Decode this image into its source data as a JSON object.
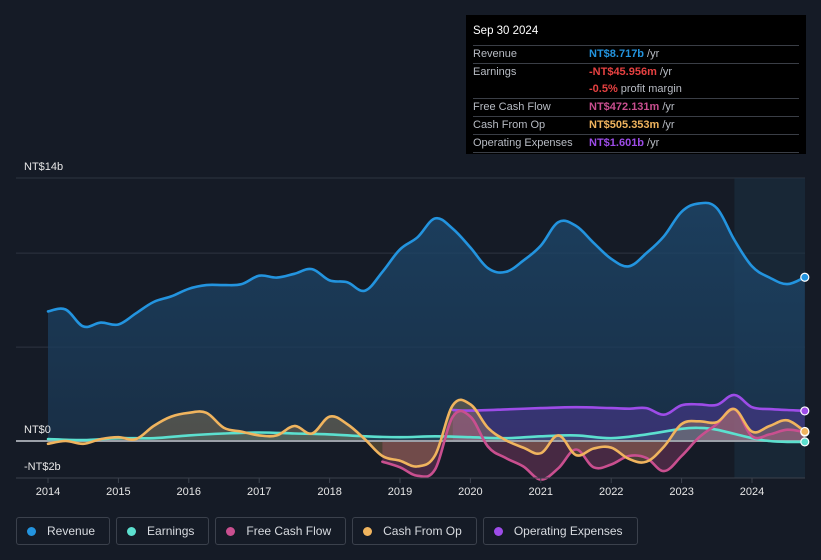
{
  "tooltip": {
    "date": "Sep 30 2024",
    "rows": [
      {
        "label": "Revenue",
        "value": "NT$8.717b",
        "suffix": "/yr",
        "color": "#2394df"
      },
      {
        "label": "Earnings",
        "value": "-NT$45.956m",
        "suffix": "/yr",
        "color": "#e64141"
      },
      {
        "label": "",
        "value": "-0.5%",
        "suffix": "profit margin",
        "color": "#e64141"
      },
      {
        "label": "Free Cash Flow",
        "value": "NT$472.131m",
        "suffix": "/yr",
        "color": "#c94f8f"
      },
      {
        "label": "Cash From Op",
        "value": "NT$505.353m",
        "suffix": "/yr",
        "color": "#f0b45e"
      },
      {
        "label": "Operating Expenses",
        "value": "NT$1.601b",
        "suffix": "/yr",
        "color": "#9d4ce8"
      }
    ]
  },
  "legend": [
    {
      "label": "Revenue",
      "color": "#2394df"
    },
    {
      "label": "Earnings",
      "color": "#5ce0cf"
    },
    {
      "label": "Free Cash Flow",
      "color": "#c94f8f"
    },
    {
      "label": "Cash From Op",
      "color": "#f0b45e"
    },
    {
      "label": "Operating Expenses",
      "color": "#9d4ce8"
    }
  ],
  "chart_data": {
    "type": "area",
    "title": "",
    "xlabel": "",
    "ylabel": "",
    "unit": "NT$ billions",
    "ylim": [
      -2,
      14
    ],
    "xlim": [
      2013.95,
      2024.75
    ],
    "y_tick_labels": [
      {
        "value": 14,
        "label": "NT$14b"
      },
      {
        "value": 0,
        "label": "NT$0"
      },
      {
        "value": -2,
        "label": "-NT$2b"
      }
    ],
    "gridlines": [
      14,
      10,
      5,
      0
    ],
    "x_tick_labels": [
      "2014",
      "2015",
      "2016",
      "2017",
      "2018",
      "2019",
      "2020",
      "2021",
      "2022",
      "2023",
      "2024"
    ],
    "x_tick_values": [
      2014,
      2015,
      2016,
      2017,
      2018,
      2019,
      2020,
      2021,
      2022,
      2023,
      2024
    ],
    "highlight_range": [
      2023.75,
      2024.75
    ],
    "series": [
      {
        "name": "Revenue",
        "color": "#2394df",
        "x": [
          2014,
          2014.25,
          2014.5,
          2014.75,
          2015,
          2015.25,
          2015.5,
          2015.75,
          2016,
          2016.25,
          2016.5,
          2016.75,
          2017,
          2017.25,
          2017.5,
          2017.75,
          2018,
          2018.25,
          2018.5,
          2018.75,
          2019,
          2019.25,
          2019.5,
          2019.75,
          2020,
          2020.25,
          2020.5,
          2020.75,
          2021,
          2021.25,
          2021.5,
          2021.75,
          2022,
          2022.25,
          2022.5,
          2022.75,
          2023,
          2023.25,
          2023.5,
          2023.75,
          2024,
          2024.25,
          2024.5,
          2024.75
        ],
        "values": [
          6.9,
          7.0,
          6.1,
          6.3,
          6.2,
          6.8,
          7.4,
          7.7,
          8.1,
          8.3,
          8.3,
          8.35,
          8.8,
          8.7,
          8.9,
          9.15,
          8.55,
          8.45,
          8.0,
          9.0,
          10.2,
          10.85,
          11.85,
          11.3,
          10.3,
          9.2,
          9.0,
          9.6,
          10.4,
          11.65,
          11.45,
          10.55,
          9.7,
          9.3,
          10.0,
          10.9,
          12.2,
          12.65,
          12.4,
          10.7,
          9.3,
          8.7,
          8.35,
          8.717
        ]
      },
      {
        "name": "Earnings",
        "color": "#5ce0cf",
        "x": [
          2014,
          2014.5,
          2015,
          2015.5,
          2016,
          2016.5,
          2017,
          2017.5,
          2018,
          2018.5,
          2019,
          2019.5,
          2020,
          2020.5,
          2021,
          2021.5,
          2022,
          2022.5,
          2023,
          2023.25,
          2023.5,
          2024,
          2024.25,
          2024.5,
          2024.75
        ],
        "values": [
          0.1,
          0.05,
          0.15,
          0.15,
          0.3,
          0.4,
          0.45,
          0.4,
          0.35,
          0.25,
          0.2,
          0.25,
          0.2,
          0.15,
          0.25,
          0.3,
          0.15,
          0.35,
          0.65,
          0.7,
          0.6,
          0.15,
          0.0,
          -0.05,
          -0.046
        ]
      },
      {
        "name": "Free Cash Flow",
        "color": "#c94f8f",
        "x": [
          2018.75,
          2019,
          2019.25,
          2019.5,
          2019.75,
          2020,
          2020.25,
          2020.5,
          2020.75,
          2021,
          2021.25,
          2021.5,
          2021.75,
          2022,
          2022.25,
          2022.5,
          2022.75,
          2023,
          2023.25,
          2023.5,
          2023.75,
          2024,
          2024.25,
          2024.5,
          2024.75
        ],
        "values": [
          -1.1,
          -1.4,
          -1.85,
          -1.5,
          1.3,
          1.3,
          -0.3,
          -0.9,
          -1.35,
          -2.05,
          -1.45,
          -0.45,
          -1.4,
          -1.25,
          -0.8,
          -0.9,
          -1.6,
          -0.8,
          0.2,
          0.9,
          1.7,
          0.25,
          0.35,
          0.6,
          0.472
        ]
      },
      {
        "name": "Cash From Op",
        "color": "#f0b45e",
        "x": [
          2014,
          2014.25,
          2014.5,
          2014.75,
          2015,
          2015.25,
          2015.5,
          2015.75,
          2016,
          2016.25,
          2016.5,
          2016.75,
          2017,
          2017.25,
          2017.5,
          2017.75,
          2018,
          2018.25,
          2018.5,
          2018.75,
          2019,
          2019.25,
          2019.5,
          2019.75,
          2020,
          2020.25,
          2020.5,
          2020.75,
          2021,
          2021.25,
          2021.5,
          2021.75,
          2022,
          2022.25,
          2022.5,
          2022.75,
          2023,
          2023.25,
          2023.5,
          2023.75,
          2024,
          2024.25,
          2024.5,
          2024.75
        ],
        "values": [
          -0.15,
          0.0,
          -0.15,
          0.1,
          0.2,
          0.1,
          0.8,
          1.3,
          1.5,
          1.5,
          0.7,
          0.5,
          0.3,
          0.3,
          0.8,
          0.4,
          1.3,
          0.9,
          0.1,
          -0.8,
          -1.05,
          -1.35,
          -0.75,
          1.9,
          1.95,
          0.7,
          0.05,
          -0.35,
          -0.65,
          0.3,
          -0.75,
          -0.4,
          -0.35,
          -0.95,
          -1.1,
          -0.3,
          0.9,
          1.05,
          1.0,
          1.7,
          0.5,
          0.8,
          1.1,
          0.505
        ]
      },
      {
        "name": "Operating Expenses",
        "color": "#9d4ce8",
        "x": [
          2019.75,
          2020,
          2020.5,
          2021,
          2021.5,
          2022,
          2022.25,
          2022.5,
          2022.75,
          2023,
          2023.25,
          2023.5,
          2023.75,
          2024,
          2024.25,
          2024.5,
          2024.75
        ],
        "values": [
          1.65,
          1.62,
          1.68,
          1.75,
          1.8,
          1.75,
          1.72,
          1.75,
          1.4,
          1.9,
          1.95,
          1.92,
          2.45,
          1.8,
          1.7,
          1.65,
          1.601
        ]
      }
    ]
  }
}
